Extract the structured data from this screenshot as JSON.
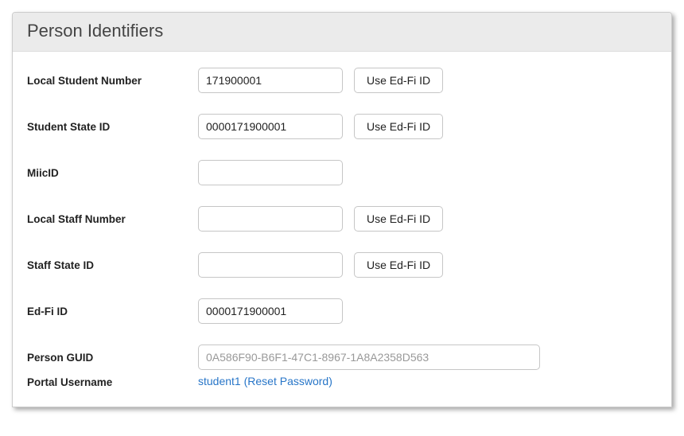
{
  "panel": {
    "title": "Person Identifiers"
  },
  "buttons": {
    "use_edfi": "Use Ed-Fi ID"
  },
  "fields": {
    "local_student_number": {
      "label": "Local Student Number",
      "value": "171900001"
    },
    "student_state_id": {
      "label": "Student State ID",
      "value": "0000171900001"
    },
    "miic_id": {
      "label": "MiicID",
      "value": ""
    },
    "local_staff_number": {
      "label": "Local Staff Number",
      "value": ""
    },
    "staff_state_id": {
      "label": "Staff State ID",
      "value": ""
    },
    "edfi_id": {
      "label": "Ed-Fi ID",
      "value": "0000171900001"
    },
    "person_guid": {
      "label": "Person GUID",
      "value": "0A586F90-B6F1-47C1-8967-1A8A2358D563"
    },
    "portal_username": {
      "label": "Portal Username",
      "value": "student1",
      "reset_link": "Reset Password"
    }
  }
}
